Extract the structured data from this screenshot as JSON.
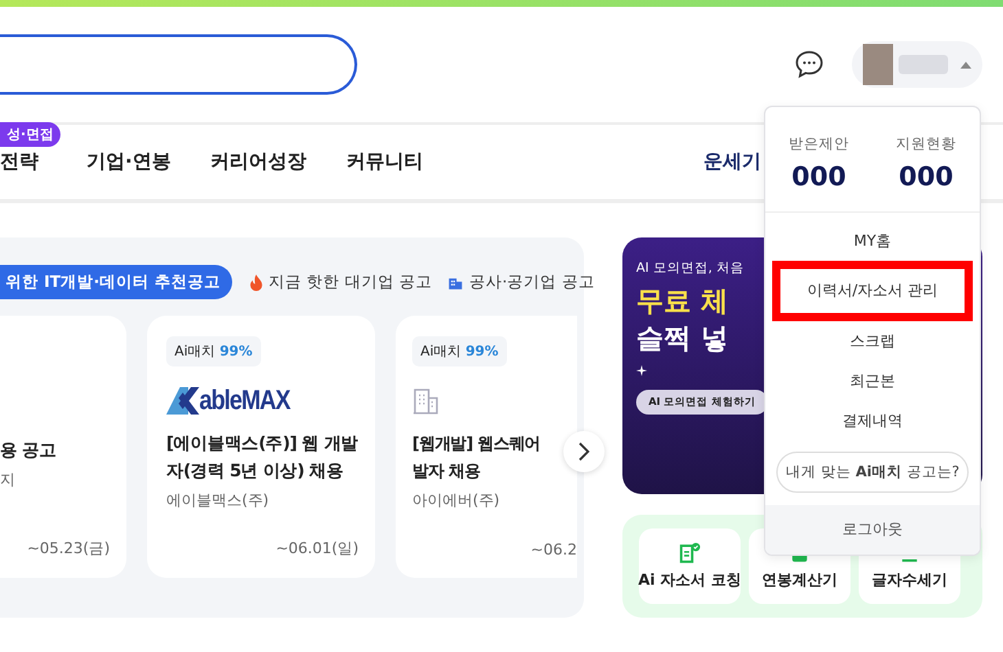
{
  "nav": {
    "badge": "성·면접",
    "items": [
      "전략",
      "기업·연봉",
      "커리어성장",
      "커뮤니티",
      "운세기"
    ]
  },
  "feed": {
    "tabs": [
      {
        "label": "위한 IT개발·데이터 추천공고",
        "selected": true,
        "kind": "plain"
      },
      {
        "label": "지금 핫한 대기업 공고",
        "selected": false,
        "kind": "fire"
      },
      {
        "label": "공사·공기업 공고",
        "selected": false,
        "kind": "building"
      }
    ],
    "cards": [
      {
        "kind": "partial",
        "title": "용 공고",
        "company": "지",
        "deadline": "~05.23(금)"
      },
      {
        "kind": "logo",
        "tag_label": "Ai매치",
        "tag_value": "99%",
        "logo_text": "ableMAX",
        "title": "[에이블맥스(주)] 웹 개발자(경력 5년 이상) 채용",
        "company": "에이블맥스(주)",
        "deadline": "~06.01(일)"
      },
      {
        "kind": "building",
        "tag_label": "Ai매치",
        "tag_value": "99%",
        "title": "[웹개발] 웹스퀘어",
        "title2": "발자 채용",
        "company": "아이에버(주)",
        "deadline": "~06.2"
      }
    ]
  },
  "banner": {
    "eyebrow": "AI 모의면접, 처음",
    "headline": "무료 체",
    "subline": "슬쩍 넣",
    "button": "AI 모의면접 체험하기"
  },
  "tools": [
    {
      "label": "Ai 자소서 코칭",
      "kind": "doc"
    },
    {
      "label": "연봉계산기",
      "kind": "calc"
    },
    {
      "label": "글자수세기",
      "kind": "count"
    }
  ],
  "menu": {
    "stats": [
      {
        "label": "받은제안",
        "value": "000"
      },
      {
        "label": "지원현황",
        "value": "000"
      }
    ],
    "items": [
      {
        "label": "MY홈",
        "highlighted": false
      },
      {
        "label": "이력서/자소서 관리",
        "highlighted": true
      },
      {
        "label": "스크랩",
        "highlighted": false
      },
      {
        "label": "최근본",
        "highlighted": false
      },
      {
        "label": "결제내역",
        "highlighted": false
      }
    ],
    "ai_match": "내게 맞는 **Ai매치** 공고는?",
    "logout": "로그아웃"
  }
}
